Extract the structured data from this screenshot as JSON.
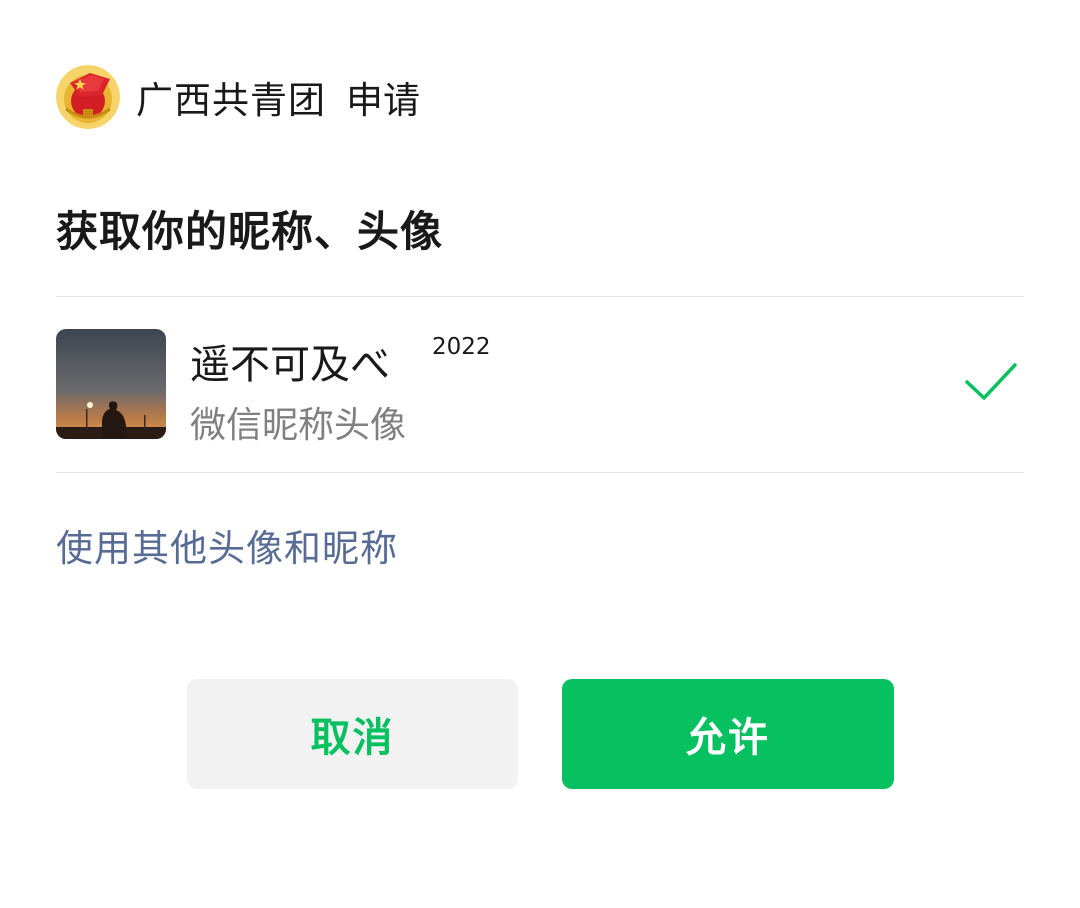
{
  "header": {
    "app_name": "广西共青团",
    "action": "申请"
  },
  "permission": {
    "title": "获取你的昵称、头像"
  },
  "profile": {
    "nickname": "遥不可及べ",
    "nickname_suffix": "2022",
    "subtitle": "微信昵称头像",
    "selected": true
  },
  "links": {
    "use_other": "使用其他头像和昵称"
  },
  "buttons": {
    "cancel": "取消",
    "allow": "允许"
  },
  "colors": {
    "primary_green": "#07c160",
    "link_blue": "#576b95",
    "secondary_gray": "#808080"
  },
  "icons": {
    "logo": "communist-youth-league-badge-icon",
    "check": "checkmark-icon"
  }
}
